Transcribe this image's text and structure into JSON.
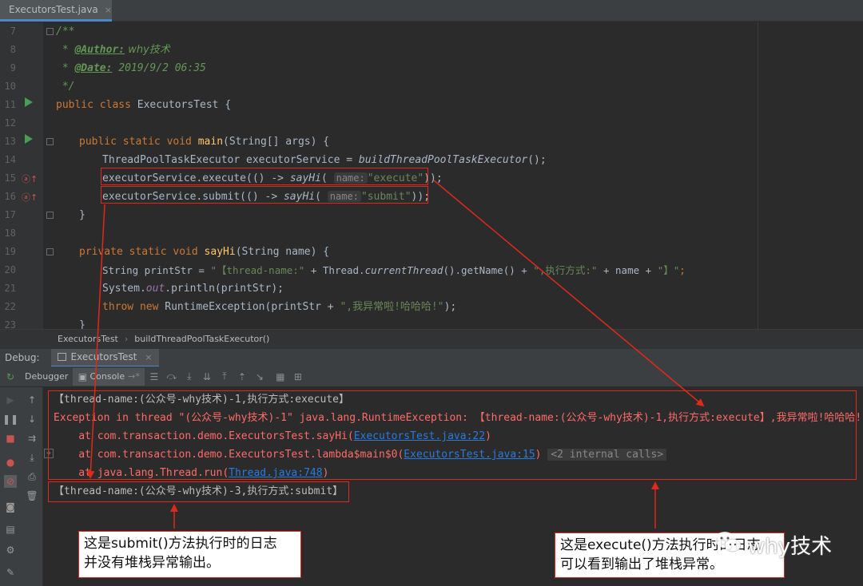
{
  "tab": {
    "title": "ExecutorsTest.java",
    "close": "×"
  },
  "editor": {
    "lines": [
      {
        "n": "7"
      },
      {
        "n": "8"
      },
      {
        "n": "9"
      },
      {
        "n": "10"
      },
      {
        "n": "11"
      },
      {
        "n": "12"
      },
      {
        "n": "13"
      },
      {
        "n": "14"
      },
      {
        "n": "15"
      },
      {
        "n": "16"
      },
      {
        "n": "17"
      },
      {
        "n": "18"
      },
      {
        "n": "19"
      },
      {
        "n": "20"
      },
      {
        "n": "21"
      },
      {
        "n": "22"
      },
      {
        "n": "23"
      }
    ],
    "code": {
      "l7": "/**",
      "l8_a": " * ",
      "l8_tag": "@Author:",
      "l8_b": " why技术",
      "l9_a": " * ",
      "l9_tag": "@Date:",
      "l9_b": " 2019/9/2 06:35",
      "l10": " */",
      "l11_kw": "public class ",
      "l11_b": "ExecutorsTest {",
      "l13_kw": "public static void ",
      "l13_fn": "main",
      "l13_b": "(String[] args) {",
      "l14_a": "ThreadPoolTaskExecutor executorService = ",
      "l14_it": "buildThreadPoolTaskExecutor",
      "l14_b": "();",
      "l15_a": "executorService.execute(() -> ",
      "l15_it": "sayHi",
      "l15_b": "( ",
      "l15_hint": "name:",
      "l15_str": "\"execute\"",
      "l15_c": "));",
      "l16_a": "executorService.submit(() -> ",
      "l16_it": "sayHi",
      "l16_b": "( ",
      "l16_hint": "name:",
      "l16_str": "\"submit\"",
      "l16_c": "));",
      "l17": "}",
      "l19_kw": "private static void ",
      "l19_fn": "sayHi",
      "l19_b": "(String name) {",
      "l20_a": "String printStr = ",
      "l20_s1": "\"【thread-name:\"",
      "l20_b": " + Thread.",
      "l20_it": "currentThread",
      "l20_c": "().getName() + ",
      "l20_s2": "\",执行方式:\"",
      "l20_d": " + name + ",
      "l20_s3": "\"】\"",
      "l20_e": ";",
      "l21_a": "System.",
      "l21_st": "out",
      "l21_b": ".println(printStr);",
      "l22_kw1": "throw new ",
      "l22_a": "RuntimeException(printStr + ",
      "l22_s": "\",我异常啦!哈哈哈!\"",
      "l22_b": ");",
      "l23": "}"
    }
  },
  "breadcrumb": {
    "item1": "ExecutorsTest",
    "sep": "›",
    "item2": "buildThreadPoolTaskExecutor()"
  },
  "debug": {
    "label": "Debug:",
    "tab": "ExecutorsTest",
    "close": "×",
    "debugger_tab": "Debugger",
    "console_tab": "Console"
  },
  "console": {
    "l1": "【thread-name:(公众号-why技术)-1,执行方式:execute】",
    "l2": "Exception in thread \"(公众号-why技术)-1\" java.lang.RuntimeException: 【thread-name:(公众号-why技术)-1,执行方式:execute】,我异常啦!哈哈哈!",
    "l3_a": "    at com.transaction.demo.ExecutorsTest.sayHi(",
    "l3_link": "ExecutorsTest.java:22",
    "l3_b": ")",
    "l4_a": "    at com.transaction.demo.ExecutorsTest.lambda$main$0(",
    "l4_link": "ExecutorsTest.java:15",
    "l4_b": ")",
    "l4_internal": "<2 internal calls>",
    "l5_a": "    at java.lang.Thread.run(",
    "l5_link": "Thread.java:748",
    "l5_b": ")",
    "l6": "【thread-name:(公众号-why技术)-3,执行方式:submit】"
  },
  "annotations": {
    "submit_note": "这是submit()方法执行时的日志\n并没有堆栈异常输出。",
    "execute_note": "这是execute()方法执行时的日志\n可以看到输出了堆栈异常。",
    "watermark": "why技术",
    "color": "#e0281b"
  }
}
